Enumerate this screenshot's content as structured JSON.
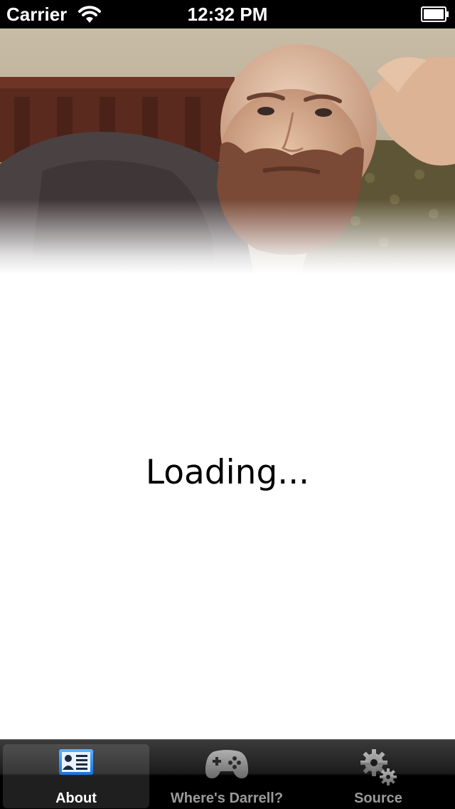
{
  "status_bar": {
    "carrier": "Carrier",
    "time": "12:32 PM"
  },
  "content": {
    "header_photo": "portrait-photo",
    "loading_text": "Loading..."
  },
  "tab_bar": {
    "selected_index": 0,
    "tabs": [
      {
        "label": "About",
        "icon": "contact-card-icon"
      },
      {
        "label": "Where's Darrell?",
        "icon": "game-controller-icon"
      },
      {
        "label": "Source",
        "icon": "gears-icon"
      }
    ]
  },
  "colors": {
    "status_bar_bg": "#000000",
    "tab_selected_label": "#ffffff",
    "tab_label": "#9a9a9a",
    "card_icon_blue": "#1d73d8"
  }
}
